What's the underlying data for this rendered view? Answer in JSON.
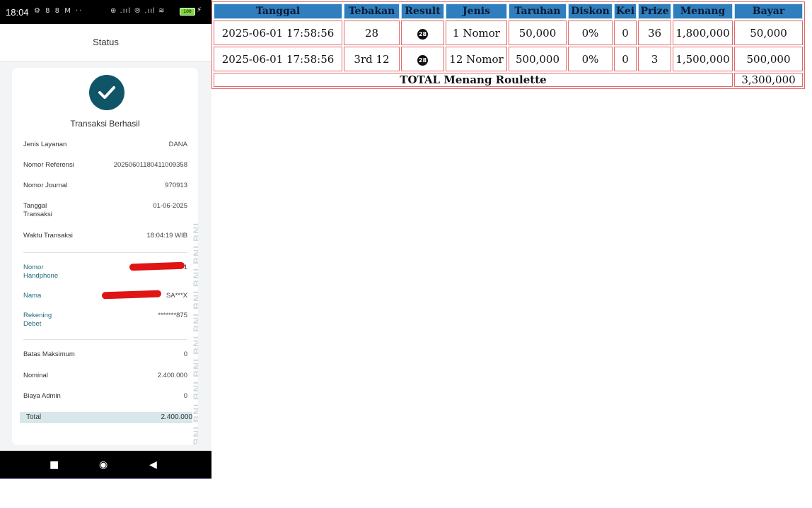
{
  "phone": {
    "status_bar": {
      "time": "18:04",
      "left_icons": "⚙ 8 8 M ··",
      "right_icons": "⊕ .ııl ® .ııl ≋",
      "battery": "100"
    },
    "header": {
      "title": "Status"
    },
    "receipt": {
      "success_icon": "check-icon",
      "title": "Transaksi Berhasil",
      "watermark": "BNI BNI BNI BNI BNI BNI BNI BNI BNI BNI",
      "fields": [
        {
          "label": "Jenis Layanan",
          "value": "DANA"
        },
        {
          "label": "Nomor Referensi",
          "value": "20250601180411009358"
        },
        {
          "label": "Nomor Journal",
          "value": "970913"
        },
        {
          "label": "Tanggal Transaksi",
          "value": "01-06-2025"
        },
        {
          "label": "Waktu Transaksi",
          "value": "18:04:19 WIB"
        }
      ],
      "account_fields": [
        {
          "label": "Nomor Handphone",
          "value": "1"
        },
        {
          "label": "Nama",
          "value": "SA***X"
        },
        {
          "label": "Rekening Debet",
          "value": "*******875"
        }
      ],
      "amount_fields": [
        {
          "label": "Batas Maksimum",
          "value": "0"
        },
        {
          "label": "Nominal",
          "value": "2.400.000"
        },
        {
          "label": "Biaya Admin",
          "value": "0"
        }
      ],
      "total": {
        "label": "Total",
        "value": "2.400.000"
      }
    },
    "nav": {
      "recent": "■",
      "home": "◉",
      "back": "◀"
    }
  },
  "table": {
    "headers": [
      "Tanggal",
      "Tebakan",
      "Result",
      "Jenis",
      "Taruhan",
      "Diskon",
      "Kei",
      "Prize",
      "Menang",
      "Bayar"
    ],
    "rows": [
      {
        "tanggal": "2025-06-01 17:58:56",
        "tebakan": "28",
        "result": "28",
        "jenis": "1 Nomor",
        "taruhan": "50,000",
        "diskon": "0%",
        "kei": "0",
        "prize": "36",
        "menang": "1,800,000",
        "bayar": "50,000"
      },
      {
        "tanggal": "2025-06-01 17:58:56",
        "tebakan": "3rd 12",
        "result": "28",
        "jenis": "12 Nomor",
        "taruhan": "500,000",
        "diskon": "0%",
        "kei": "0",
        "prize": "3",
        "menang": "1,500,000",
        "bayar": "500,000"
      }
    ],
    "total_label": "TOTAL  Menang Roulette",
    "total_value": "3,300,000"
  }
}
